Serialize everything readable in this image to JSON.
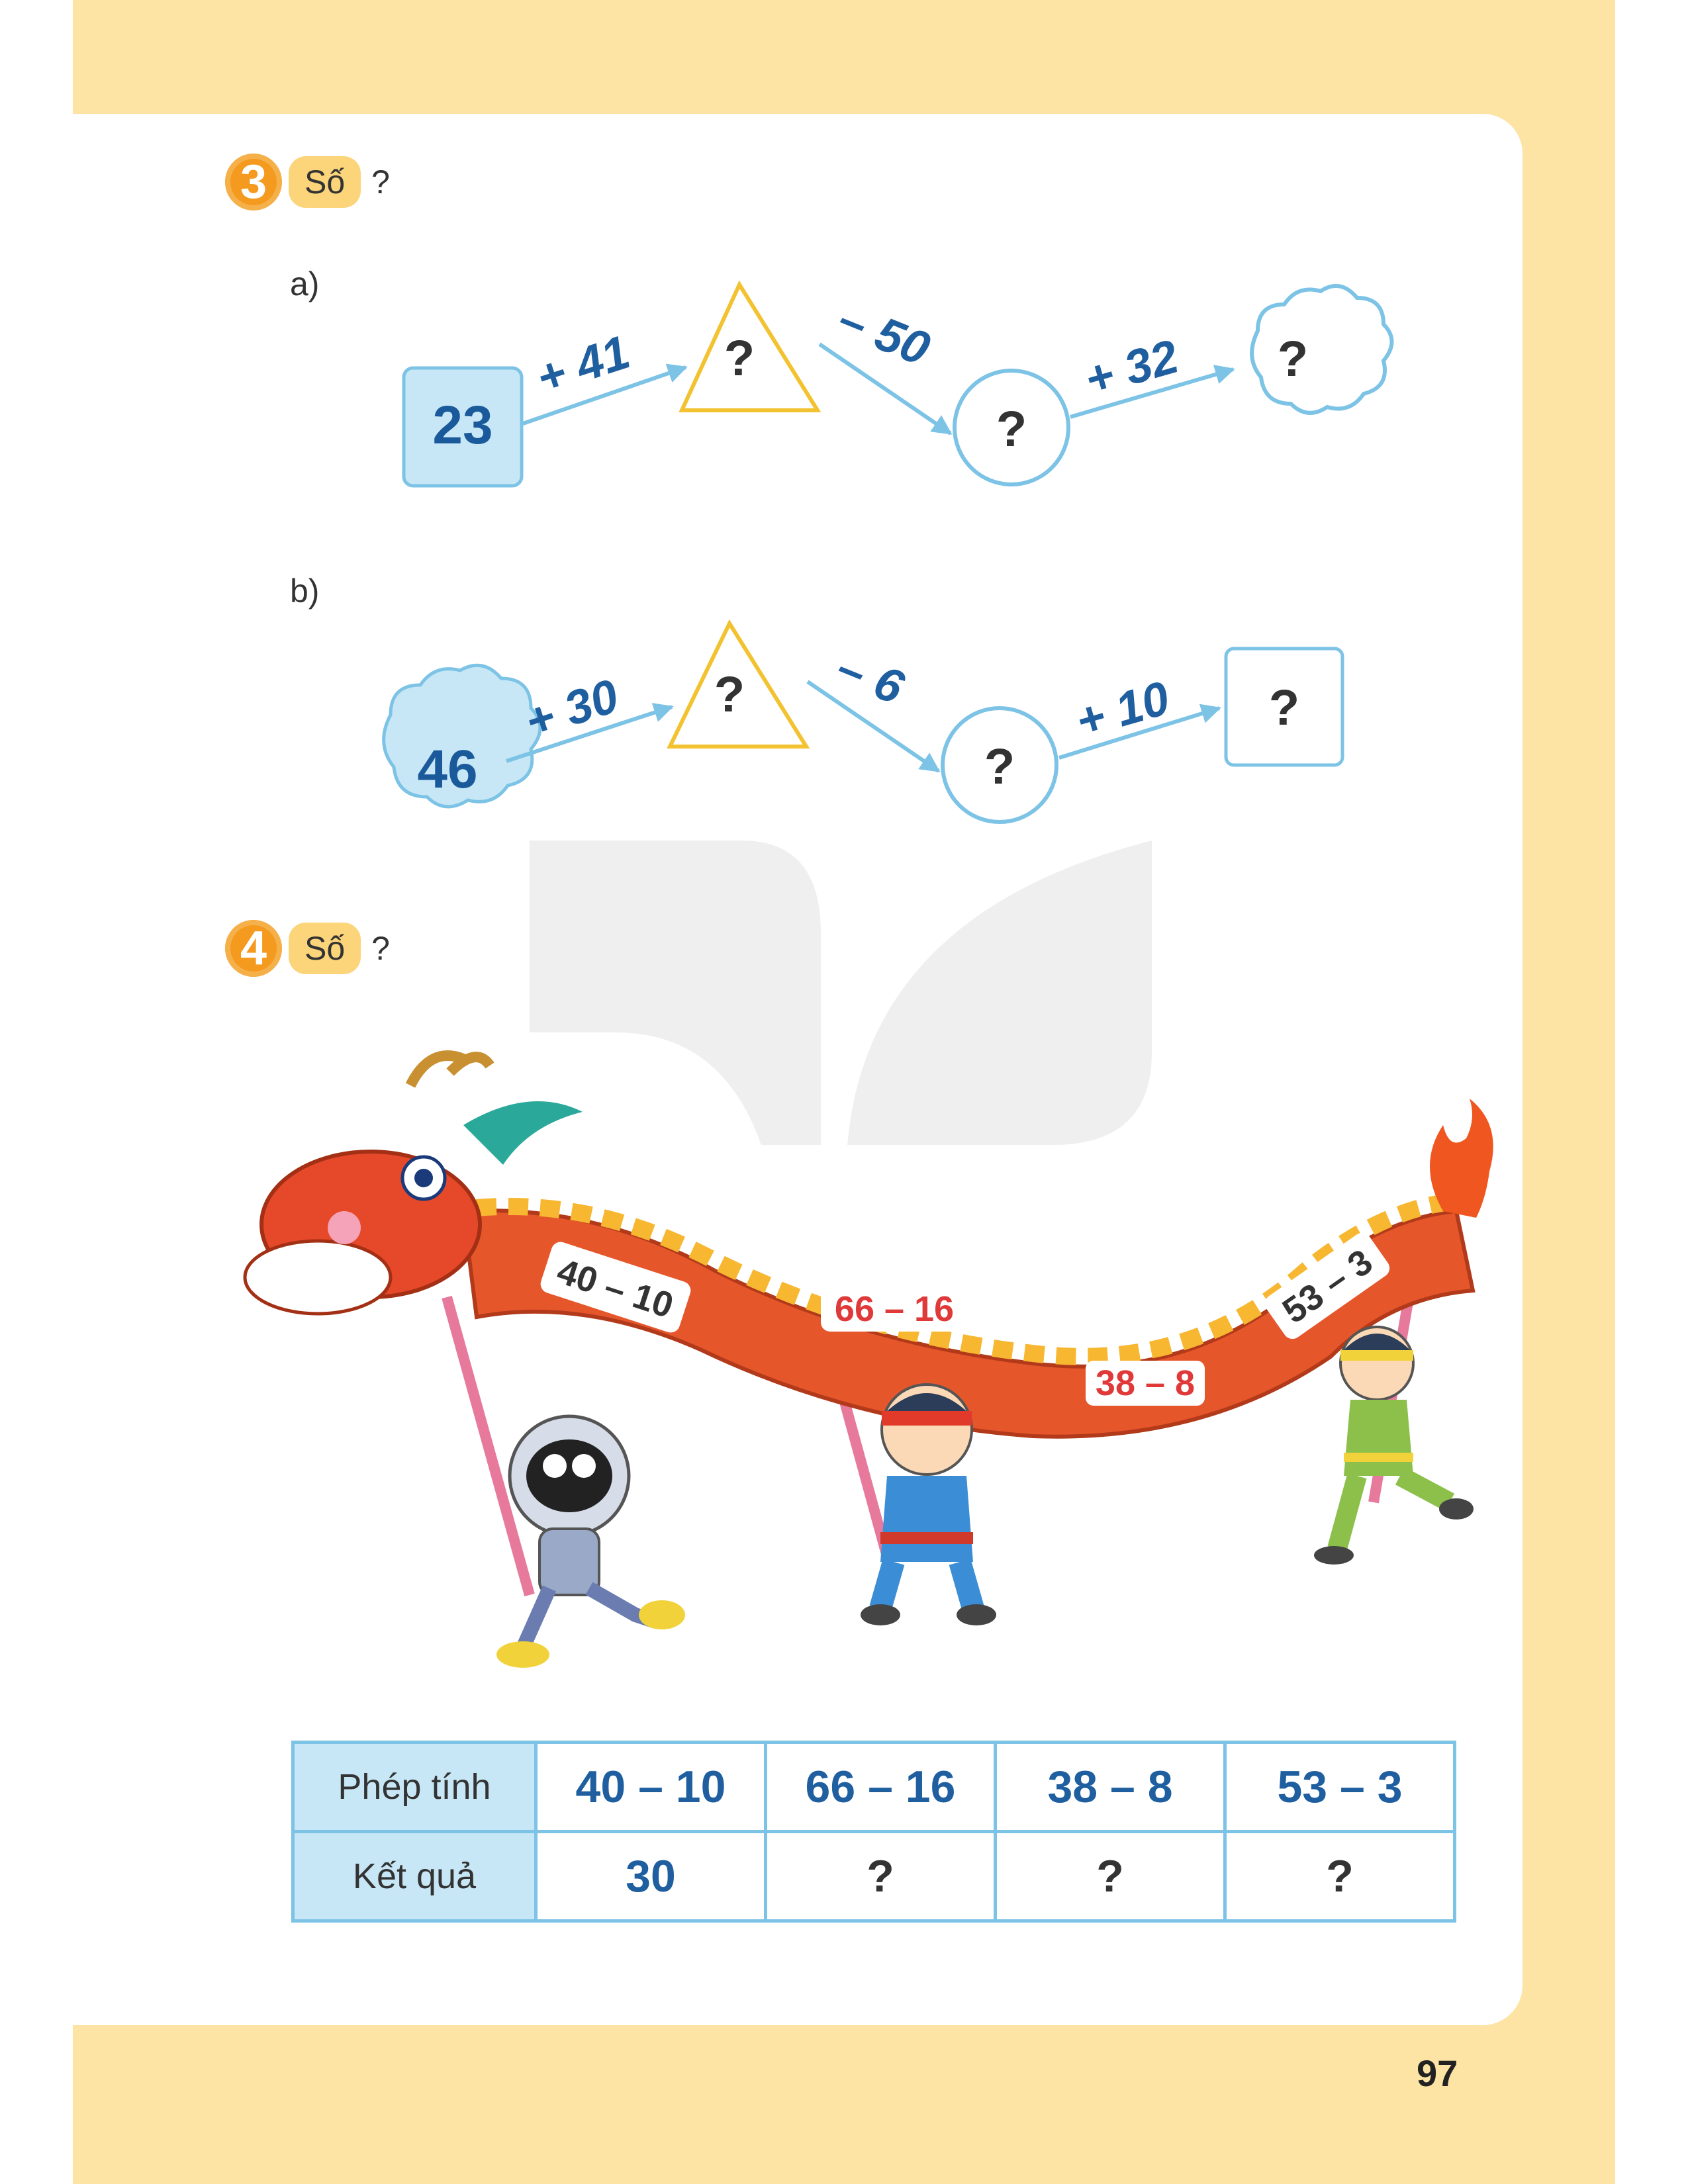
{
  "exercise3": {
    "number": "3",
    "tag": "Số",
    "question_mark": "?",
    "part_a": {
      "label": "a)",
      "start": "23",
      "ops": [
        "+ 41",
        "– 50",
        "+ 32"
      ],
      "answers": [
        "?",
        "?",
        "?"
      ]
    },
    "part_b": {
      "label": "b)",
      "start": "46",
      "ops": [
        "+ 30",
        "– 6",
        "+ 10"
      ],
      "answers": [
        "?",
        "?",
        "?"
      ]
    }
  },
  "exercise4": {
    "number": "4",
    "tag": "Số",
    "question_mark": "?",
    "dragon_labels": [
      "40 – 10",
      "66 – 16",
      "38 – 8",
      "53 – 3"
    ],
    "table": {
      "row1_header": "Phép tính",
      "row2_header": "Kết quả",
      "operations": [
        "40 – 10",
        "66 – 16",
        "38 – 8",
        "53 – 3"
      ],
      "results": [
        "30",
        "?",
        "?",
        "?"
      ]
    }
  },
  "page_number": "97",
  "colors": {
    "page_bg": "#fde3a4",
    "accent_orange": "#f39a1f",
    "tag_yellow": "#fcd47a",
    "flow_blue": "#7cc3e6",
    "triangle_yellow": "#f2c230",
    "number_blue": "#1f5fa0"
  }
}
